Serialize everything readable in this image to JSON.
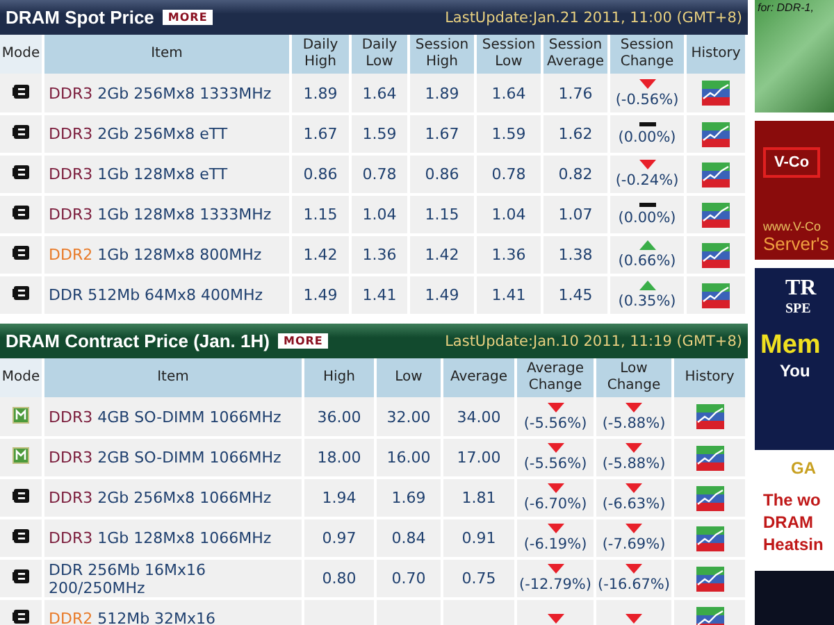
{
  "spot": {
    "title": "DRAM Spot Price",
    "more": "MORE",
    "last_update": "LastUpdate:Jan.21 2011, 11:00 (GMT+8)",
    "columns": [
      "Mode",
      "Item",
      "Daily High",
      "Daily Low",
      "Session High",
      "Session Low",
      "Session Average",
      "Session Change",
      "History"
    ],
    "rows": [
      {
        "kind": "chip",
        "prefix": "DDR3",
        "color": "#7a1a3a",
        "spec": "2Gb 256Mx8 1333MHz",
        "values": [
          "1.89",
          "1.64",
          "1.89",
          "1.64",
          "1.76"
        ],
        "changes": [
          {
            "kind": "down",
            "text": "(-0.56%)"
          }
        ]
      },
      {
        "kind": "chip",
        "prefix": "DDR3",
        "color": "#7a1a3a",
        "spec": "2Gb 256Mx8 eTT",
        "values": [
          "1.67",
          "1.59",
          "1.67",
          "1.59",
          "1.62"
        ],
        "changes": [
          {
            "kind": "flat",
            "text": "(0.00%)"
          }
        ]
      },
      {
        "kind": "chip",
        "prefix": "DDR3",
        "color": "#7a1a3a",
        "spec": "1Gb 128Mx8 eTT",
        "values": [
          "0.86",
          "0.78",
          "0.86",
          "0.78",
          "0.82"
        ],
        "changes": [
          {
            "kind": "down",
            "text": "(-0.24%)"
          }
        ]
      },
      {
        "kind": "chip",
        "prefix": "DDR3",
        "color": "#7a1a3a",
        "spec": "1Gb 128Mx8 1333MHz",
        "values": [
          "1.15",
          "1.04",
          "1.15",
          "1.04",
          "1.07"
        ],
        "changes": [
          {
            "kind": "flat",
            "text": "(0.00%)"
          }
        ]
      },
      {
        "kind": "chip",
        "prefix": "DDR2",
        "color": "#e87a28",
        "spec": "1Gb 128Mx8 800MHz",
        "values": [
          "1.42",
          "1.36",
          "1.42",
          "1.36",
          "1.38"
        ],
        "changes": [
          {
            "kind": "up",
            "text": "(0.66%)"
          }
        ]
      },
      {
        "kind": "chip",
        "prefix": "DDR",
        "color": "#1e3f6e",
        "spec": "512Mb 64Mx8 400MHz",
        "values": [
          "1.49",
          "1.41",
          "1.49",
          "1.41",
          "1.45"
        ],
        "changes": [
          {
            "kind": "up",
            "text": "(0.35%)"
          }
        ]
      }
    ]
  },
  "contract": {
    "title": "DRAM Contract Price (Jan. 1H)",
    "more": "MORE",
    "last_update": "LastUpdate:Jan.10 2011, 11:19 (GMT+8)",
    "columns": [
      "Mode",
      "Item",
      "High",
      "Low",
      "Average",
      "Average Change",
      "Low Change",
      "History"
    ],
    "rows": [
      {
        "kind": "module",
        "prefix": "DDR3",
        "color": "#7a1a3a",
        "spec": "4GB SO-DIMM 1066MHz",
        "values": [
          "36.00",
          "32.00",
          "34.00"
        ],
        "changes": [
          {
            "kind": "down",
            "text": "(-5.56%)"
          },
          {
            "kind": "down",
            "text": "(-5.88%)"
          }
        ]
      },
      {
        "kind": "module",
        "prefix": "DDR3",
        "color": "#7a1a3a",
        "spec": "2GB SO-DIMM 1066MHz",
        "values": [
          "18.00",
          "16.00",
          "17.00"
        ],
        "changes": [
          {
            "kind": "down",
            "text": "(-5.56%)"
          },
          {
            "kind": "down",
            "text": "(-5.88%)"
          }
        ]
      },
      {
        "kind": "chip",
        "prefix": "DDR3",
        "color": "#7a1a3a",
        "spec": "2Gb 256Mx8 1066MHz",
        "values": [
          "1.94",
          "1.69",
          "1.81"
        ],
        "changes": [
          {
            "kind": "down",
            "text": "(-6.70%)"
          },
          {
            "kind": "down",
            "text": "(-6.63%)"
          }
        ]
      },
      {
        "kind": "chip",
        "prefix": "DDR3",
        "color": "#7a1a3a",
        "spec": "1Gb 128Mx8 1066MHz",
        "values": [
          "0.97",
          "0.84",
          "0.91"
        ],
        "changes": [
          {
            "kind": "down",
            "text": "(-6.19%)"
          },
          {
            "kind": "down",
            "text": "(-7.69%)"
          }
        ]
      },
      {
        "kind": "chip",
        "prefix": "DDR",
        "color": "#1e3f6e",
        "spec": "256Mb 16Mx16 200/250MHz",
        "values": [
          "0.80",
          "0.70",
          "0.75"
        ],
        "changes": [
          {
            "kind": "down",
            "text": "(-12.79%)"
          },
          {
            "kind": "down",
            "text": "(-16.67%)"
          }
        ]
      },
      {
        "kind": "chip",
        "prefix": "DDR2",
        "color": "#e87a28",
        "spec": "512Mb 32Mx16",
        "values": [],
        "changes": [
          {
            "kind": "down"
          },
          {
            "kind": "down"
          }
        ]
      }
    ]
  },
  "ads": [
    {
      "kind": "photo",
      "lines": [
        "for: DDR-1,"
      ]
    },
    {
      "kind": "red",
      "lines": [
        "V-Co",
        "www.V-Co",
        "Server's"
      ]
    },
    {
      "kind": "navy",
      "lines": [
        "TR",
        "SPE",
        "Mem",
        "You"
      ]
    },
    {
      "kind": "white",
      "lines": [
        "GA",
        "The wo",
        "DRAM",
        "Heatsin"
      ]
    },
    {
      "kind": "dark"
    }
  ]
}
